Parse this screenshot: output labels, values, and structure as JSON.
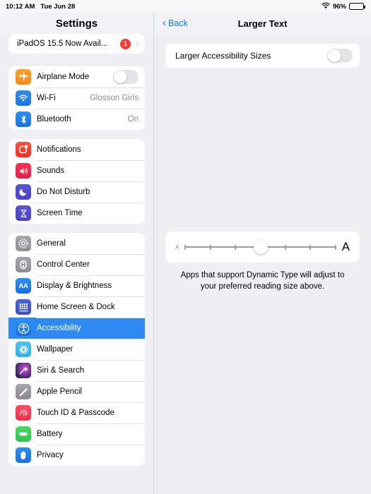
{
  "statusbar": {
    "time": "10:12 AM",
    "date": "Tue Jun 28",
    "wifi_icon": "wifi-icon",
    "battery_percent": "96%",
    "battery_level": 96
  },
  "sidebar": {
    "title": "Settings",
    "update_row": {
      "label": "iPadOS 15.5 Now Avail...",
      "badge": "1",
      "chevron": "›",
      "icon": "software-update-icon"
    },
    "groups": [
      {
        "name": "connectivity",
        "items": [
          {
            "label": "Airplane Mode",
            "icon": "airplane-icon",
            "control": "toggle",
            "toggle_on": false,
            "value": ""
          },
          {
            "label": "Wi-Fi",
            "icon": "wifi-icon",
            "control": "value",
            "value": "Glosson Girls"
          },
          {
            "label": "Bluetooth",
            "icon": "bluetooth-icon",
            "control": "value",
            "value": "On"
          }
        ]
      },
      {
        "name": "alerts",
        "items": [
          {
            "label": "Notifications",
            "icon": "notifications-icon",
            "control": "none",
            "value": ""
          },
          {
            "label": "Sounds",
            "icon": "sounds-icon",
            "control": "none",
            "value": ""
          },
          {
            "label": "Do Not Disturb",
            "icon": "do-not-disturb-icon",
            "control": "none",
            "value": ""
          },
          {
            "label": "Screen Time",
            "icon": "screen-time-icon",
            "control": "none",
            "value": ""
          }
        ]
      },
      {
        "name": "system",
        "items": [
          {
            "label": "General",
            "icon": "gear-icon",
            "control": "none",
            "value": "",
            "selected": false
          },
          {
            "label": "Control Center",
            "icon": "control-center-icon",
            "control": "none",
            "value": "",
            "selected": false
          },
          {
            "label": "Display & Brightness",
            "icon": "display-brightness-icon",
            "control": "none",
            "value": "",
            "selected": false
          },
          {
            "label": "Home Screen & Dock",
            "icon": "home-screen-dock-icon",
            "control": "none",
            "value": "",
            "selected": false
          },
          {
            "label": "Accessibility",
            "icon": "accessibility-icon",
            "control": "none",
            "value": "",
            "selected": true
          },
          {
            "label": "Wallpaper",
            "icon": "wallpaper-icon",
            "control": "none",
            "value": "",
            "selected": false
          },
          {
            "label": "Siri & Search",
            "icon": "siri-search-icon",
            "control": "none",
            "value": "",
            "selected": false
          },
          {
            "label": "Apple Pencil",
            "icon": "apple-pencil-icon",
            "control": "none",
            "value": "",
            "selected": false
          },
          {
            "label": "Touch ID & Passcode",
            "icon": "touch-id-icon",
            "control": "none",
            "value": "",
            "selected": false
          },
          {
            "label": "Battery",
            "icon": "battery-icon",
            "control": "none",
            "value": "",
            "selected": false
          },
          {
            "label": "Privacy",
            "icon": "privacy-icon",
            "control": "none",
            "value": "",
            "selected": false
          }
        ]
      }
    ]
  },
  "detail": {
    "back_label": "Back",
    "back_chevron": "‹",
    "title": "Larger Text",
    "toggle_row": {
      "label": "Larger Accessibility Sizes",
      "toggle_on": false
    },
    "slider": {
      "small_label": "A",
      "large_label": "A",
      "steps": 7,
      "value": 4
    },
    "caption": "Apps that support Dynamic Type will adjust to your preferred reading size above."
  },
  "colors": {
    "accent": "#0a7cff",
    "selected_row": "#2e8af2",
    "badge_red": "#ff3b30",
    "toggle_off": "#e4e4e8",
    "toggle_on": "#34c759",
    "background": "#eeeef3",
    "card": "#ffffff",
    "secondary_text": "#8a8a8e"
  }
}
